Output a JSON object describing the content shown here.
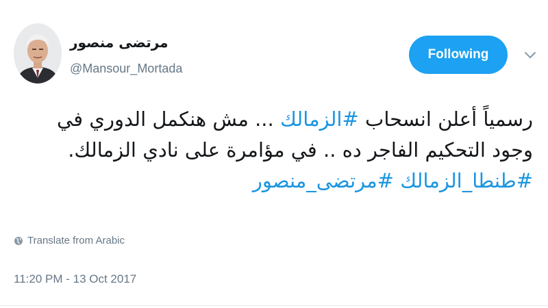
{
  "user": {
    "display_name": "مرتضى منصور",
    "handle": "@Mansour_Mortada"
  },
  "follow_button": {
    "label": "Following"
  },
  "menu_caret_icon": "chevron-down-icon",
  "tweet": {
    "line1_prefix": "رسمياً أعلن انسحاب ",
    "line1_hashtag": "#الزمالك",
    "line1_suffix": " ... مش هنكمل الدوري في",
    "line2": "وجود التحكيم الفاجر ده .. في مؤامرة على نادي الزمالك.",
    "hashtag2": "#طنطا_الزمالك",
    "hashtag3": "#مرتضى_منصور"
  },
  "translate": {
    "icon": "globe-icon",
    "label": "Translate from Arabic"
  },
  "timestamp": "11:20 PM - 13 Oct 2017",
  "colors": {
    "accent": "#1da1f2",
    "hashtag": "#1b95e0",
    "muted": "#657786"
  }
}
